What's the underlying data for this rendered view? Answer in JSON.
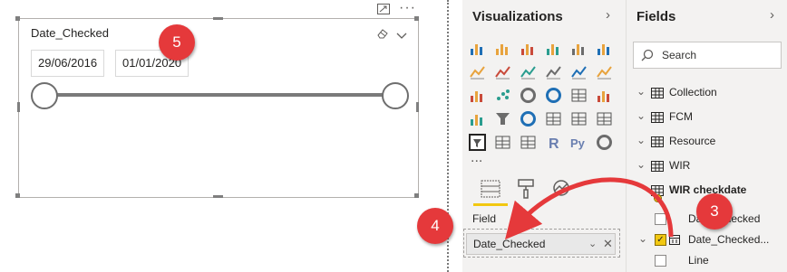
{
  "canvas": {
    "slicer": {
      "title": "Date_Checked",
      "start_date": "29/06/2016",
      "end_date": "01/01/2020"
    },
    "toolbar_icons": [
      "focus-mode-icon",
      "more-options-icon"
    ],
    "slicer_icons": [
      "eraser-icon",
      "chevron-down-icon"
    ]
  },
  "visualizations": {
    "title": "Visualizations",
    "more_label": "...",
    "tabs": [
      "fields-tab",
      "format-tab",
      "analytics-tab"
    ],
    "well_label": "Field",
    "well_value": "Date_Checked"
  },
  "fields": {
    "title": "Fields",
    "search_placeholder": "Search",
    "tables": [
      {
        "name": "Collection",
        "expanded": false
      },
      {
        "name": "FCM",
        "expanded": false
      },
      {
        "name": "Resource",
        "expanded": false
      },
      {
        "name": "WIR",
        "expanded": false
      },
      {
        "name": "WIR checkdate",
        "expanded": true
      }
    ],
    "children": [
      {
        "name": "Date_Checked",
        "checked": false
      },
      {
        "name": "Date_Checked...",
        "checked": true
      },
      {
        "name": "Line",
        "checked": false
      }
    ]
  },
  "callouts": [
    "3",
    "4",
    "5"
  ],
  "colors": {
    "callout": "#e5393b",
    "accent_yellow": "#f2c811",
    "pane_bg": "#f3f2f1"
  }
}
